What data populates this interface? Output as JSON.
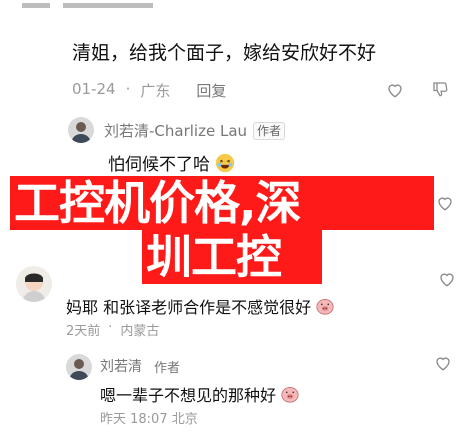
{
  "comment_top": {
    "text": "清姐，给我个面子，嫁给安欣好不好",
    "meta_date": "01-24",
    "meta_location": "广东",
    "reply_label": "回复"
  },
  "reply_charlize": {
    "name": "刘若清-Charlize Lau",
    "badge": "作者",
    "text": "怕伺候不了哈"
  },
  "overlay": {
    "line1": "工控机价格,深",
    "line2": "圳工控",
    "color": "#ff1a1a"
  },
  "comment_bottom": {
    "text": "妈耶 和张译老师合作是不感觉很好",
    "meta_date": "2天前",
    "meta_location": "内蒙古"
  },
  "reply_bottom": {
    "name": "刘若清",
    "badge": "作者",
    "text": "嗯一辈子不想见的那种好",
    "meta": "昨天 18:07 北京"
  },
  "icons": {
    "like": "heart-outline-icon",
    "dislike": "thumbs-down-icon",
    "reply_emoji": "laughing-emoji-icon",
    "pig": "pig-face-emoji-icon"
  }
}
